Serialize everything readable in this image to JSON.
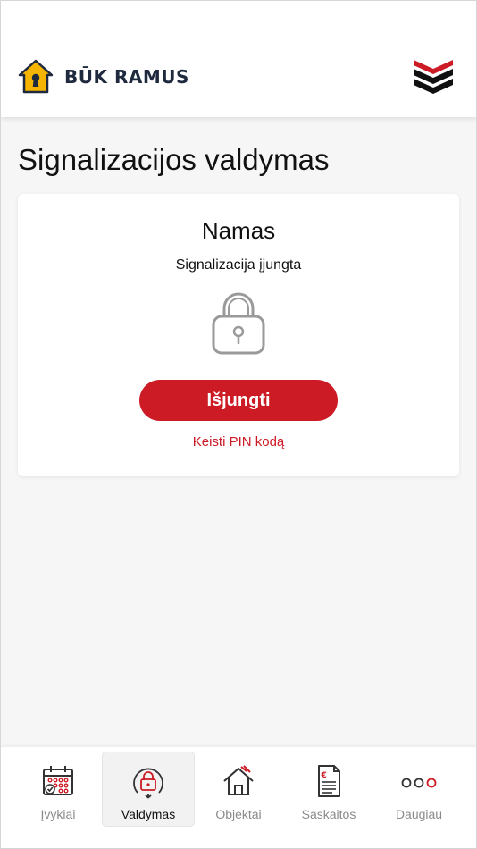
{
  "header": {
    "brand": "BŪK RAMUS"
  },
  "page": {
    "title": "Signalizacijos valdymas"
  },
  "card": {
    "object_name": "Namas",
    "status": "Signalizacija įjungta",
    "action_label": "Išjungti",
    "pin_link": "Keisti PIN kodą"
  },
  "tabs": [
    {
      "label": "Įvykiai",
      "icon": "calendar-icon",
      "active": false
    },
    {
      "label": "Valdymas",
      "icon": "lock-control-icon",
      "active": true
    },
    {
      "label": "Objektai",
      "icon": "house-icon",
      "active": false
    },
    {
      "label": "Saskaitos",
      "icon": "invoice-icon",
      "active": false
    },
    {
      "label": "Daugiau",
      "icon": "more-dots-icon",
      "active": false
    }
  ],
  "colors": {
    "accent": "#cc1b25",
    "brand_navy": "#1f2a3f",
    "brand_yellow": "#f4b400"
  }
}
